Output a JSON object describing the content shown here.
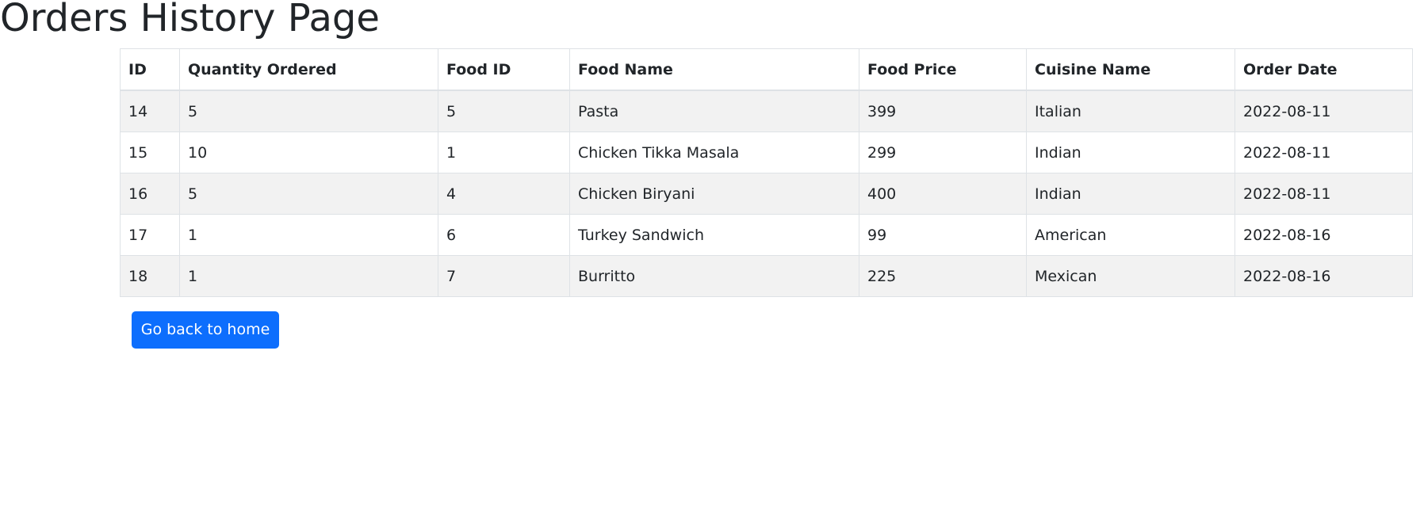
{
  "page": {
    "title": "Orders History Page"
  },
  "table": {
    "columns": [
      "ID",
      "Quantity Ordered",
      "Food ID",
      "Food Name",
      "Food Price",
      "Cuisine Name",
      "Order Date"
    ],
    "rows": [
      [
        "14",
        "5",
        "5",
        "Pasta",
        "399",
        "Italian",
        "2022-08-11"
      ],
      [
        "15",
        "10",
        "1",
        "Chicken Tikka Masala",
        "299",
        "Indian",
        "2022-08-11"
      ],
      [
        "16",
        "5",
        "4",
        "Chicken Biryani",
        "400",
        "Indian",
        "2022-08-11"
      ],
      [
        "17",
        "1",
        "6",
        "Turkey Sandwich",
        "99",
        "American",
        "2022-08-16"
      ],
      [
        "18",
        "1",
        "7",
        "Burritto",
        "225",
        "Mexican",
        "2022-08-16"
      ]
    ]
  },
  "actions": {
    "home_button_label": "Go back to home"
  },
  "colors": {
    "primary": "#0d6efd",
    "stripe": "#f2f2f2",
    "text": "#212529",
    "border": "#dee2e6"
  }
}
